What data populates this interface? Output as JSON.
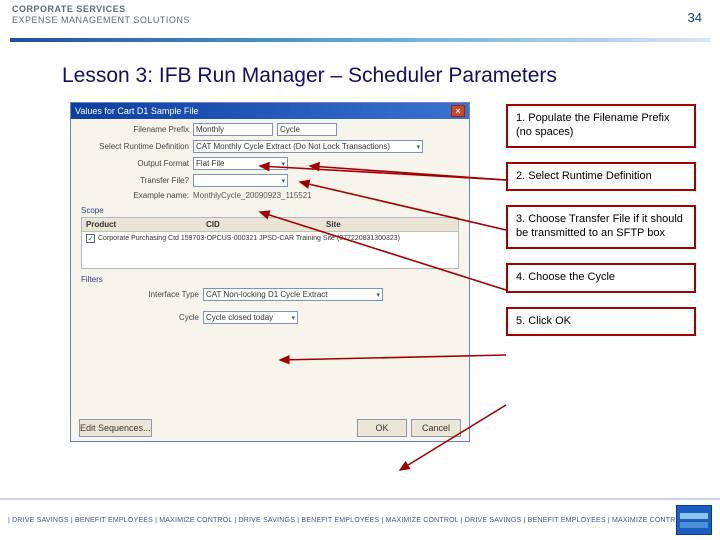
{
  "header": {
    "line1": "CORPORATE SERVICES",
    "line2": "EXPENSE MANAGEMENT SOLUTIONS",
    "page_number": "34"
  },
  "title": "Lesson 3: IFB Run Manager – Scheduler Parameters",
  "dialog": {
    "title": "Values for Cart D1 Sample File",
    "fields": {
      "filename_prefix_label": "Filename Prefix",
      "filename_prefix_value1": "Monthly",
      "filename_prefix_value2": "Cycle",
      "runtime_def_label": "Select Runtime Definition",
      "runtime_def_value": "CAT Monthly Cycle Extract (Do Not Lock Transactions)",
      "output_format_label": "Output Format",
      "output_format_value": "Flat File",
      "transfer_file_label": "Transfer File?",
      "example_label": "Example name:",
      "example_value": "MonthlyCycle_20090923_115521"
    },
    "scope_label": "Scope",
    "scope_headers": {
      "product": "Product",
      "cid": "CID",
      "site": "Site"
    },
    "scope_row": "Corporate Purchasing Ctd  159703-OPCUS-000321  JPSD-CAR Training Site (077220831300323)",
    "filters_label": "Filters",
    "filter_row": {
      "interface_type_label": "Interface Type",
      "interface_type_value": "CAT Non-locking D1 Cycle Extract",
      "cycle_label": "Cycle",
      "cycle_value": "Cycle closed today"
    },
    "buttons": {
      "edit_sequences": "Edit Sequences...",
      "ok": "OK",
      "cancel": "Cancel"
    }
  },
  "callouts": [
    "1. Populate the Filename Prefix (no spaces)",
    "2. Select Runtime Definition",
    "3. Choose Transfer File if it should be transmitted to an SFTP box",
    "4. Choose the Cycle",
    "5. Click OK"
  ],
  "footer": {
    "tagline": "| DRIVE SAVINGS | BENEFIT EMPLOYEES | MAXIMIZE CONTROL | DRIVE SAVINGS | BENEFIT EMPLOYEES | MAXIMIZE CONTROL | DRIVE SAVINGS | BENEFIT EMPLOYEES | MAXIMIZE CONTROL | REAL BUSINESS. REAL SOLUTIONS.®"
  }
}
